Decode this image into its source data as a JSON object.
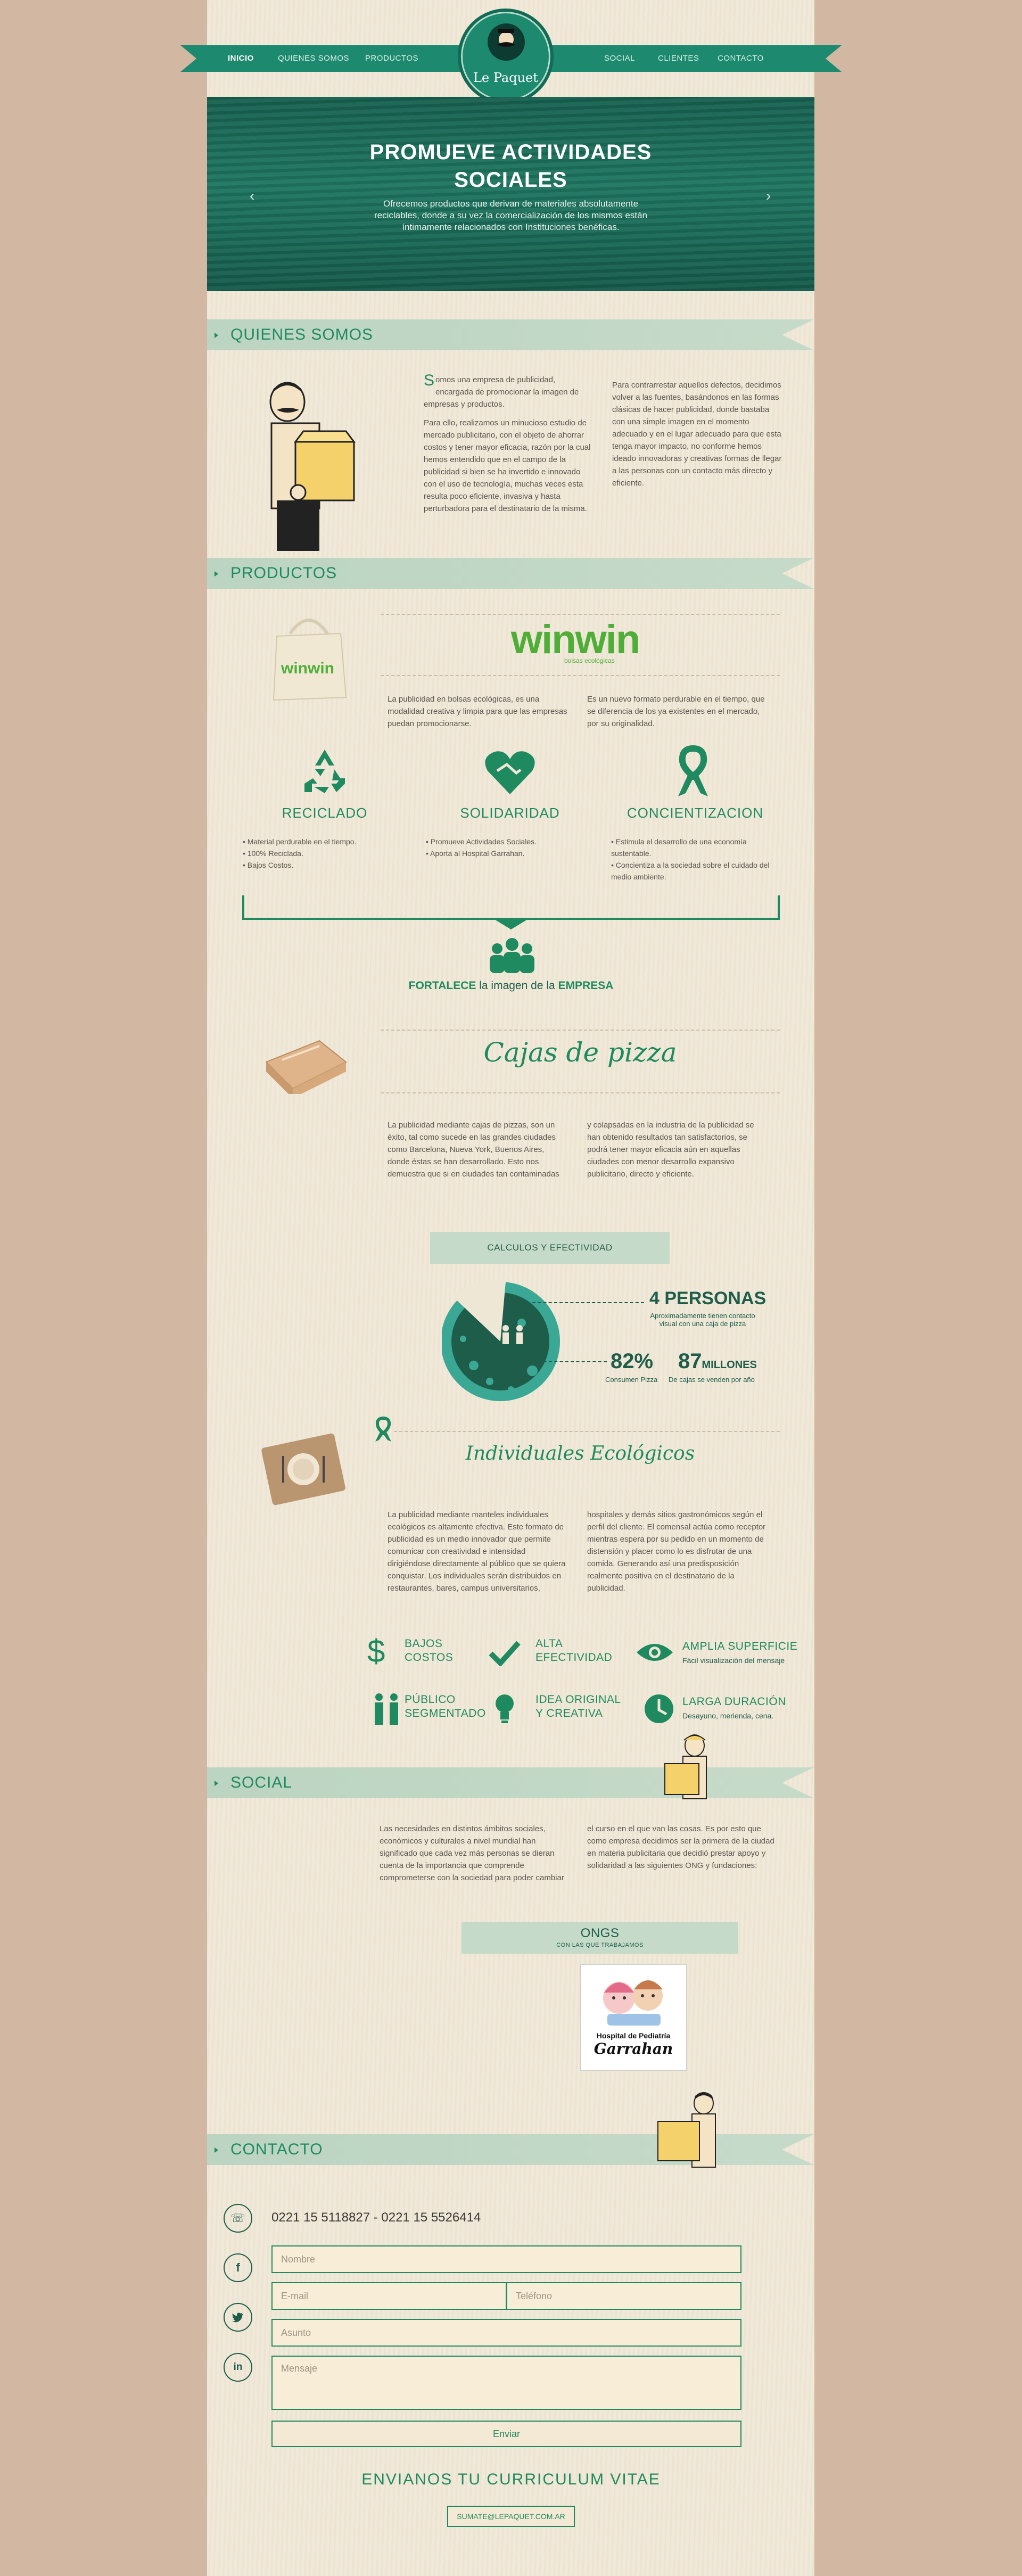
{
  "nav": {
    "items_left": [
      "INICIO",
      "QUIENES SOMOS",
      "PRODUCTOS"
    ],
    "items_right": [
      "SOCIAL",
      "CLIENTES",
      "CONTACTO"
    ],
    "logo_text": "Le Paquet"
  },
  "hero": {
    "title_line1": "PROMUEVE ACTIVIDADES",
    "title_line2": "SOCIALES",
    "text": "Ofrecemos productos que derivan de materiales absolutamente reciclables, donde a su vez la comercialización de los mismos están íntimamente relacionados con Instituciones benéficas."
  },
  "quienes": {
    "title": "QUIENES SOMOS",
    "col1_dropcap": "S",
    "col1_p1": "omos una empresa de publicidad, encargada de promocionar la imagen de empresas y productos.",
    "col1_p2": "Para ello, realizamos un minucioso estudio de mercado publicitario, con el objeto de ahorrar costos y tener mayor eficacia, razón por la cual hemos entendido que en el campo de la publicidad si bien se ha invertido e innovado con el uso de tecnología, muchas veces esta resulta poco eficiente, invasiva y hasta perturbadora para el destinatario de la misma.",
    "col2_p1": "Para contrarrestar aquellos defectos, decidimos volver a las fuentes, basándonos en las formas clásicas de hacer publicidad, donde bastaba con una simple imagen en el momento adecuado y en el lugar adecuado para que esta tenga mayor impacto, no conforme hemos ideado innovadoras y creativas formas de llegar a las personas con un contacto más directo y eficiente."
  },
  "productos": {
    "title": "PRODUCTOS",
    "winwin": "winwin",
    "winwin_sub": "bolsas ecológicas",
    "bag_text": "winwin",
    "p_left": "La publicidad en bolsas ecológicas, es una modalidad creativa y limpia para que las empresas puedan promocionarse.",
    "p_right": "Es un nuevo formato perdurable en el tiempo, que se diferencia de los ya existentes en el mercado, por su originalidad.",
    "features": [
      {
        "title": "RECICLADO",
        "items": [
          "• Material perdurable en el tiempo.",
          "• 100% Reciclada.",
          "• Bajos Costos."
        ]
      },
      {
        "title": "SOLIDARIDAD",
        "items": [
          "• Promueve Actividades Sociales.",
          "• Aporta al Hospital Garrahan."
        ]
      },
      {
        "title": "CONCIENTIZACION",
        "items": [
          "• Estimula el desarrollo de una economía sustentable.",
          "• Concientiza a la sociedad sobre el cuidado del medio ambiente."
        ]
      }
    ],
    "fortalece_a": "FORTALECE",
    "fortalece_b": " la imagen de la ",
    "fortalece_c": "EMPRESA"
  },
  "pizza": {
    "title": "Cajas de pizza",
    "p_left": "La publicidad mediante cajas de pizzas, son un éxito, tal como sucede en las grandes ciudades como Barcelona, Nueva York, Buenos Aires, donde éstas se han desarrollado. Esto nos demuestra que si en ciudades tan contaminadas",
    "p_right": "y colapsadas en la industria de la publicidad se han obtenido resultados tan satisfactorios, se podrá tener mayor eficacia aún en aquellas ciudades con menor desarrollo expansivo publicitario, directo y eficiente.",
    "stats_ribbon": "CALCULOS Y EFECTIVIDAD",
    "stat1_big": "4 PERSONAS",
    "stat1_small1": "Aproximadamente tienen contacto",
    "stat1_small2": "visual con una caja de pizza",
    "stat2_big": "82%",
    "stat2_small": "Consumen Pizza",
    "stat3_big": "87",
    "stat3_unit": "MILLONES",
    "stat3_small": "De cajas se venden por año"
  },
  "individuales": {
    "title": "Individuales Ecológicos",
    "p_left": "La publicidad mediante manteles individuales ecológicos es altamente efectiva. Este formato de publicidad es un medio innovador que permite comunicar con creatividad e intensidad dirigiéndose directamente al público que se quiera conquistar. Los individuales serán distribuidos en restaurantes, bares, campus universitarios,",
    "p_right": "hospitales y demás sitios gastronómicos según el perfil del cliente. El comensal actúa como receptor mientras espera por su pedido en un momento de distensión y placer como lo es disfrutar de una comida. Generando así una predisposición realmente positiva en el destinatario de la publicidad.",
    "benefits": [
      {
        "l1": "BAJOS",
        "l2": "COSTOS",
        "small": ""
      },
      {
        "l1": "ALTA",
        "l2": "EFECTIVIDAD",
        "small": ""
      },
      {
        "l1": "AMPLIA SUPERFICIE",
        "l2": "",
        "small": "Fácil visualización del mensaje"
      },
      {
        "l1": "PÚBLICO",
        "l2": "SEGMENTADO",
        "small": ""
      },
      {
        "l1": "IDEA ORIGINAL",
        "l2": "Y CREATIVA",
        "small": ""
      },
      {
        "l1": "LARGA DURACIÓN",
        "l2": "",
        "small": "Desayuno, merienda, cena."
      }
    ]
  },
  "social": {
    "title": "SOCIAL",
    "p_left": "Las necesidades en distintos ámbitos sociales, económicos y culturales a nivel mundial han significado que cada vez más personas se dieran cuenta de la importancia que comprende comprometerse con la sociedad para poder cambiar",
    "p_right": "el curso en el que van las cosas. Es por esto que como empresa decidimos ser la primera de la ciudad en materia publicitaria que decidió prestar apoyo y solidaridad a las siguientes ONG y fundaciones:",
    "ongs_title": "ONGS",
    "ongs_sub": "CON LAS QUE TRABAJAMOS",
    "hospital_line1": "Hospital de Pediatría",
    "hospital_line2": "Garrahan"
  },
  "contacto": {
    "title": "CONTACTO",
    "phone": "0221 15 5118827 - 0221 15 5526414",
    "placeholders": {
      "nombre": "Nombre",
      "email": "E-mail",
      "telefono": "Teléfono",
      "asunto": "Asunto",
      "mensaje": "Mensaje"
    },
    "send": "Enviar",
    "cv_title": "ENVIANOS TU CURRICULUM VITAE",
    "cv_mail": "SUMATE@LEPAQUET.COM.AR"
  },
  "colors": {
    "accent": "#1f8a5f",
    "nav": "#1d8a70",
    "ribbon": "#c6dac9",
    "background": "#d2b8a2",
    "page": "#efe7d6"
  }
}
